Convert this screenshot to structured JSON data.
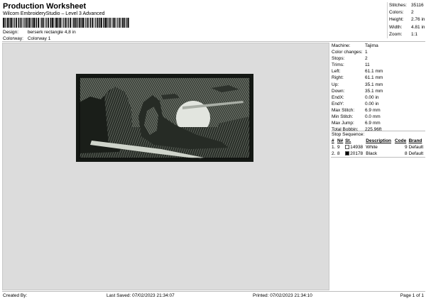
{
  "header": {
    "title": "Production Worksheet",
    "subtitle": "Wilcom EmbroideryStudio – Level 3 Advanced"
  },
  "design": {
    "design_label": "Design:",
    "design_value": "berserk rectangle 4,8 in",
    "colorway_label": "Colorway:",
    "colorway_value": "Colorway 1"
  },
  "stats": [
    {
      "key": "Stitches:",
      "value": "35116"
    },
    {
      "key": "Colors:",
      "value": "2"
    },
    {
      "key": "Height:",
      "value": "2.76 in"
    },
    {
      "key": "Width:",
      "value": "4.81 in"
    },
    {
      "key": "Zoom:",
      "value": "1:1"
    }
  ],
  "machine": [
    {
      "key": "Machine:",
      "value": "Tajima"
    },
    {
      "key": "Color changes:",
      "value": "1"
    },
    {
      "key": "Stops:",
      "value": "2"
    },
    {
      "key": "Trims:",
      "value": "11"
    },
    {
      "key": "Left:",
      "value": "61.1 mm"
    },
    {
      "key": "Right:",
      "value": "61.1 mm"
    },
    {
      "key": "Up:",
      "value": "35.1 mm"
    },
    {
      "key": "Down:",
      "value": "35.1 mm"
    },
    {
      "key": "EndX:",
      "value": "0.00 in"
    },
    {
      "key": "EndY:",
      "value": "0.00 in"
    },
    {
      "key": "Max Stitch:",
      "value": "6.9 mm"
    },
    {
      "key": "Min Stitch:",
      "value": "0.0 mm"
    },
    {
      "key": "Max Jump:",
      "value": "6.9 mm"
    },
    {
      "key": "Total Bobbin:",
      "value": "225.96ft"
    }
  ],
  "stop_sequence": {
    "title": "Stop Sequence:",
    "headers": {
      "num": "#",
      "n": "N#",
      "st": "St.",
      "description": "Description",
      "code": "Code",
      "brand": "Brand"
    },
    "rows": [
      {
        "num": "1.",
        "n": "9",
        "st": "14938",
        "swatch": "#ffffff",
        "description": "White",
        "code": "9",
        "brand": "Default"
      },
      {
        "num": "2.",
        "n": "8",
        "st": "20178",
        "swatch": "#000000",
        "description": "Black",
        "code": "8",
        "brand": "Default"
      }
    ]
  },
  "footer": {
    "created": "Created By:",
    "last_saved": "Last Saved: 07/02/2023 21:34:07",
    "printed": "Printed: 07/02/2023 21:34:10",
    "page": "Page 1 of 1"
  },
  "colors": {
    "canvas": "#dcdcdc",
    "patch_dark": "#1d221d",
    "patch_light": "#d9ddd6"
  }
}
